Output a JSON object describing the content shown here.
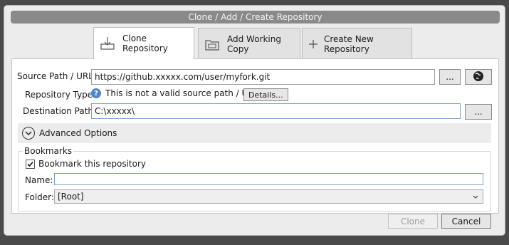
{
  "window": {
    "title": "Clone  / Add / Create Repository"
  },
  "tabs": [
    {
      "label": "Clone Repository",
      "icon": "clone-download-icon",
      "active": true
    },
    {
      "label": "Add Working Copy",
      "icon": "folder-icon",
      "active": false
    },
    {
      "label": "Create New Repository",
      "icon": "plus-icon",
      "active": false
    }
  ],
  "form": {
    "source_label": "Source Path / URL:",
    "source_value": "https://github.xxxxx.com/user/myfork.git",
    "browse_label": "...",
    "repo_type_label": "Repository Type:",
    "repo_type_text": "This is not a valid source path / URL",
    "details_label": "Details...",
    "dest_label": "Destination Path:",
    "dest_value": "C:\\xxxxx\\",
    "dest_browse_label": "..."
  },
  "advanced": {
    "label": "Advanced Options"
  },
  "bookmarks": {
    "title": "Bookmarks",
    "checkbox_label": "Bookmark this repository",
    "checked": true,
    "name_label": "Name:",
    "name_value": "",
    "folder_label": "Folder:",
    "folder_value": "[Root]"
  },
  "footer": {
    "clone_label": "Clone",
    "cancel_label": "Cancel"
  },
  "colors": {
    "title_bg": "#8a8a8a",
    "panel_bg": "#ffffff",
    "help_icon": "#4f86c6"
  }
}
